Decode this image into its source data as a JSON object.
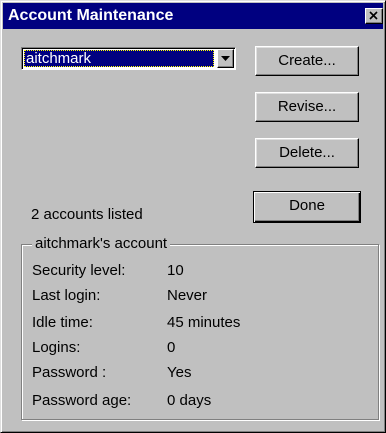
{
  "window": {
    "title": "Account Maintenance",
    "close_glyph": "×",
    "colors": {
      "face": "#c0c0c0",
      "titlebar": "#000080",
      "selection": "#000080"
    }
  },
  "account_select": {
    "selected": "aitchmark"
  },
  "buttons": {
    "create": "Create...",
    "revise": "Revise...",
    "delete": "Delete...",
    "done": "Done"
  },
  "status": {
    "count_text": "2 accounts listed"
  },
  "details": {
    "group_title": "aitchmark's account",
    "rows": [
      {
        "label": "Security level:",
        "value": "10"
      },
      {
        "label": "Last login:",
        "value": "Never"
      },
      {
        "label": "Idle time:",
        "value": "45 minutes"
      },
      {
        "label": "Logins:",
        "value": "0"
      },
      {
        "label": "Password :",
        "value": "Yes"
      },
      {
        "label": "Password age:",
        "value": "0 days"
      }
    ]
  },
  "icons": {
    "close": "close-icon",
    "dropdown": "chevron-down-icon"
  }
}
